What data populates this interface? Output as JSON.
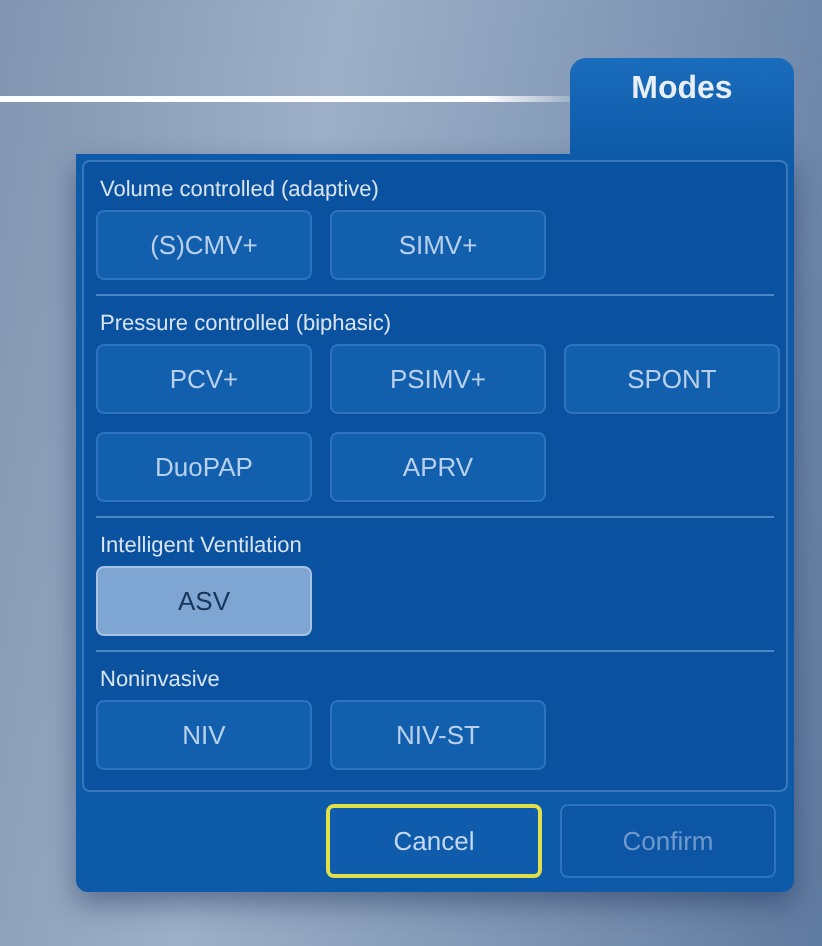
{
  "tab": {
    "label": "Modes"
  },
  "sections": [
    {
      "title": "Volume controlled (adaptive)",
      "modes": [
        {
          "label": "(S)CMV+",
          "selected": false
        },
        {
          "label": "SIMV+",
          "selected": false
        }
      ]
    },
    {
      "title": "Pressure controlled (biphasic)",
      "modes": [
        {
          "label": "PCV+",
          "selected": false
        },
        {
          "label": "PSIMV+",
          "selected": false
        },
        {
          "label": "SPONT",
          "selected": false
        },
        {
          "label": "DuoPAP",
          "selected": false
        },
        {
          "label": "APRV",
          "selected": false
        }
      ]
    },
    {
      "title": "Intelligent Ventilation",
      "modes": [
        {
          "label": "ASV",
          "selected": true
        }
      ]
    },
    {
      "title": "Noninvasive",
      "modes": [
        {
          "label": "NIV",
          "selected": false
        },
        {
          "label": "NIV-ST",
          "selected": false
        }
      ]
    }
  ],
  "footer_buttons": [
    {
      "label": "Cancel",
      "focused": true,
      "disabled": false
    },
    {
      "label": "Confirm",
      "focused": false,
      "disabled": true
    }
  ]
}
